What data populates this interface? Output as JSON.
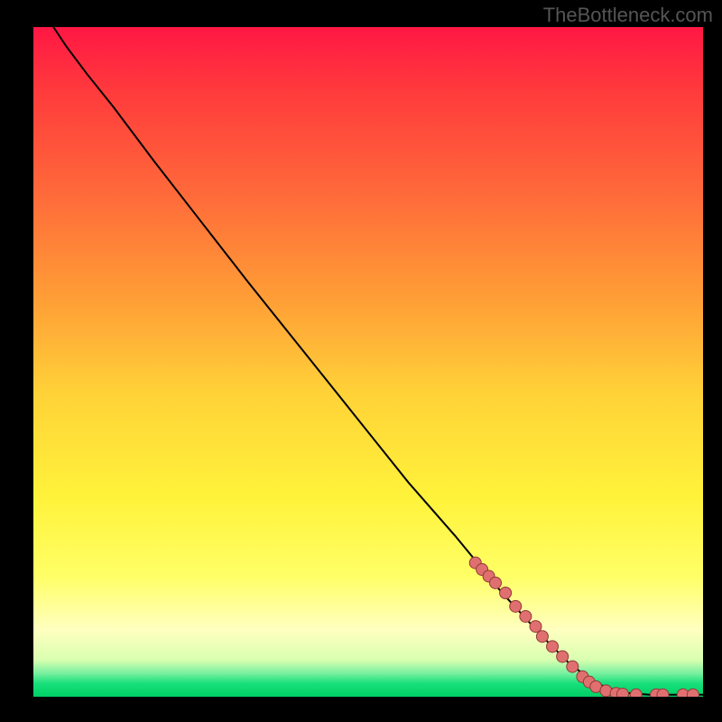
{
  "watermark": "TheBottleneck.com",
  "chart_data": {
    "type": "line",
    "title": "",
    "xlabel": "",
    "ylabel": "",
    "xlim": [
      0,
      100
    ],
    "ylim": [
      0,
      100
    ],
    "background_gradient_stops": [
      {
        "offset": 0.0,
        "color": "#ff1744"
      },
      {
        "offset": 0.1,
        "color": "#ff3c3c"
      },
      {
        "offset": 0.25,
        "color": "#ff6a3a"
      },
      {
        "offset": 0.4,
        "color": "#ff9c36"
      },
      {
        "offset": 0.55,
        "color": "#ffd338"
      },
      {
        "offset": 0.7,
        "color": "#fff23a"
      },
      {
        "offset": 0.82,
        "color": "#ffff66"
      },
      {
        "offset": 0.9,
        "color": "#ffffc0"
      },
      {
        "offset": 0.945,
        "color": "#d9ffb0"
      },
      {
        "offset": 0.965,
        "color": "#78f0a0"
      },
      {
        "offset": 0.98,
        "color": "#18e07a"
      },
      {
        "offset": 1.0,
        "color": "#00d066"
      }
    ],
    "curve": [
      {
        "x": 3,
        "y": 100
      },
      {
        "x": 5,
        "y": 97
      },
      {
        "x": 8,
        "y": 93
      },
      {
        "x": 12,
        "y": 88
      },
      {
        "x": 18,
        "y": 80
      },
      {
        "x": 25,
        "y": 71
      },
      {
        "x": 32,
        "y": 62
      },
      {
        "x": 40,
        "y": 52
      },
      {
        "x": 48,
        "y": 42
      },
      {
        "x": 56,
        "y": 32
      },
      {
        "x": 63,
        "y": 24
      },
      {
        "x": 70,
        "y": 15.5
      },
      {
        "x": 76,
        "y": 9
      },
      {
        "x": 80,
        "y": 5
      },
      {
        "x": 84,
        "y": 2
      },
      {
        "x": 88,
        "y": 0.6
      },
      {
        "x": 92,
        "y": 0.3
      },
      {
        "x": 96,
        "y": 0.3
      },
      {
        "x": 100,
        "y": 0.3
      }
    ],
    "markers": [
      {
        "x": 66,
        "y": 20
      },
      {
        "x": 67,
        "y": 19
      },
      {
        "x": 68,
        "y": 18
      },
      {
        "x": 69,
        "y": 17
      },
      {
        "x": 70.5,
        "y": 15.5
      },
      {
        "x": 72,
        "y": 13.5
      },
      {
        "x": 73.5,
        "y": 12
      },
      {
        "x": 75,
        "y": 10.5
      },
      {
        "x": 76,
        "y": 9
      },
      {
        "x": 77.5,
        "y": 7.5
      },
      {
        "x": 79,
        "y": 6
      },
      {
        "x": 80.5,
        "y": 4.5
      },
      {
        "x": 82,
        "y": 3
      },
      {
        "x": 83,
        "y": 2.2
      },
      {
        "x": 84,
        "y": 1.5
      },
      {
        "x": 85.5,
        "y": 0.9
      },
      {
        "x": 87,
        "y": 0.5
      },
      {
        "x": 88,
        "y": 0.4
      },
      {
        "x": 90,
        "y": 0.3
      },
      {
        "x": 93,
        "y": 0.3
      },
      {
        "x": 94,
        "y": 0.3
      },
      {
        "x": 97,
        "y": 0.3
      },
      {
        "x": 98.5,
        "y": 0.3
      }
    ],
    "marker_style": {
      "fill": "#e07070",
      "stroke": "#943838",
      "r": 6.5
    },
    "curve_style": {
      "stroke": "#000000",
      "width": 2
    }
  }
}
